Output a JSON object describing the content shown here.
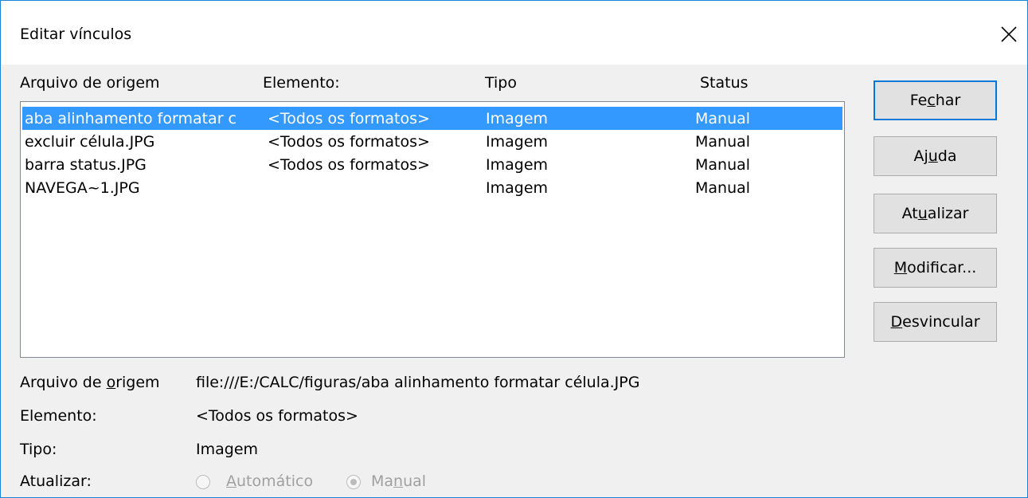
{
  "dialog": {
    "title": "Editar vínculos",
    "close_icon": "close-icon"
  },
  "list": {
    "headers": [
      "Arquivo de origem",
      "Elemento:",
      "Tipo",
      "Status"
    ],
    "rows": [
      {
        "source": "aba alinhamento formatar c",
        "element": "<Todos os formatos>",
        "type": "Imagem",
        "status": "Manual",
        "selected": true
      },
      {
        "source": "excluir célula.JPG",
        "element": "<Todos os formatos>",
        "type": "Imagem",
        "status": "Manual",
        "selected": false
      },
      {
        "source": "barra status.JPG",
        "element": "<Todos os formatos>",
        "type": "Imagem",
        "status": "Manual",
        "selected": false
      },
      {
        "source": "NAVEGA~1.JPG",
        "element": "",
        "type": "Imagem",
        "status": "Manual",
        "selected": false
      }
    ],
    "selection_color": "#3399ff"
  },
  "buttons": {
    "close": {
      "pre": "Fe",
      "key": "c",
      "post": "har"
    },
    "help": {
      "pre": "Aj",
      "key": "u",
      "post": "da"
    },
    "update": {
      "pre": "At",
      "key": "u",
      "post": "alizar"
    },
    "modify": {
      "pre": "",
      "key": "M",
      "post": "odificar..."
    },
    "unlink": {
      "pre": "",
      "key": "D",
      "post": "esvincular"
    }
  },
  "details": {
    "source_label": {
      "pre": "Arquivo de ",
      "key": "o",
      "post": "rigem"
    },
    "source_value": "file:///E:/CALC/figuras/aba alinhamento formatar célula.JPG",
    "element_label": "Elemento:",
    "element_value": "<Todos os formatos>",
    "type_label": "Tipo:",
    "type_value": "Imagem",
    "update_label": "Atualizar:",
    "auto_option": {
      "pre": "",
      "key": "A",
      "post": "utomático"
    },
    "manual_option": {
      "pre": "Ma",
      "key": "n",
      "post": "ual"
    },
    "selected_mode": "Manual"
  }
}
